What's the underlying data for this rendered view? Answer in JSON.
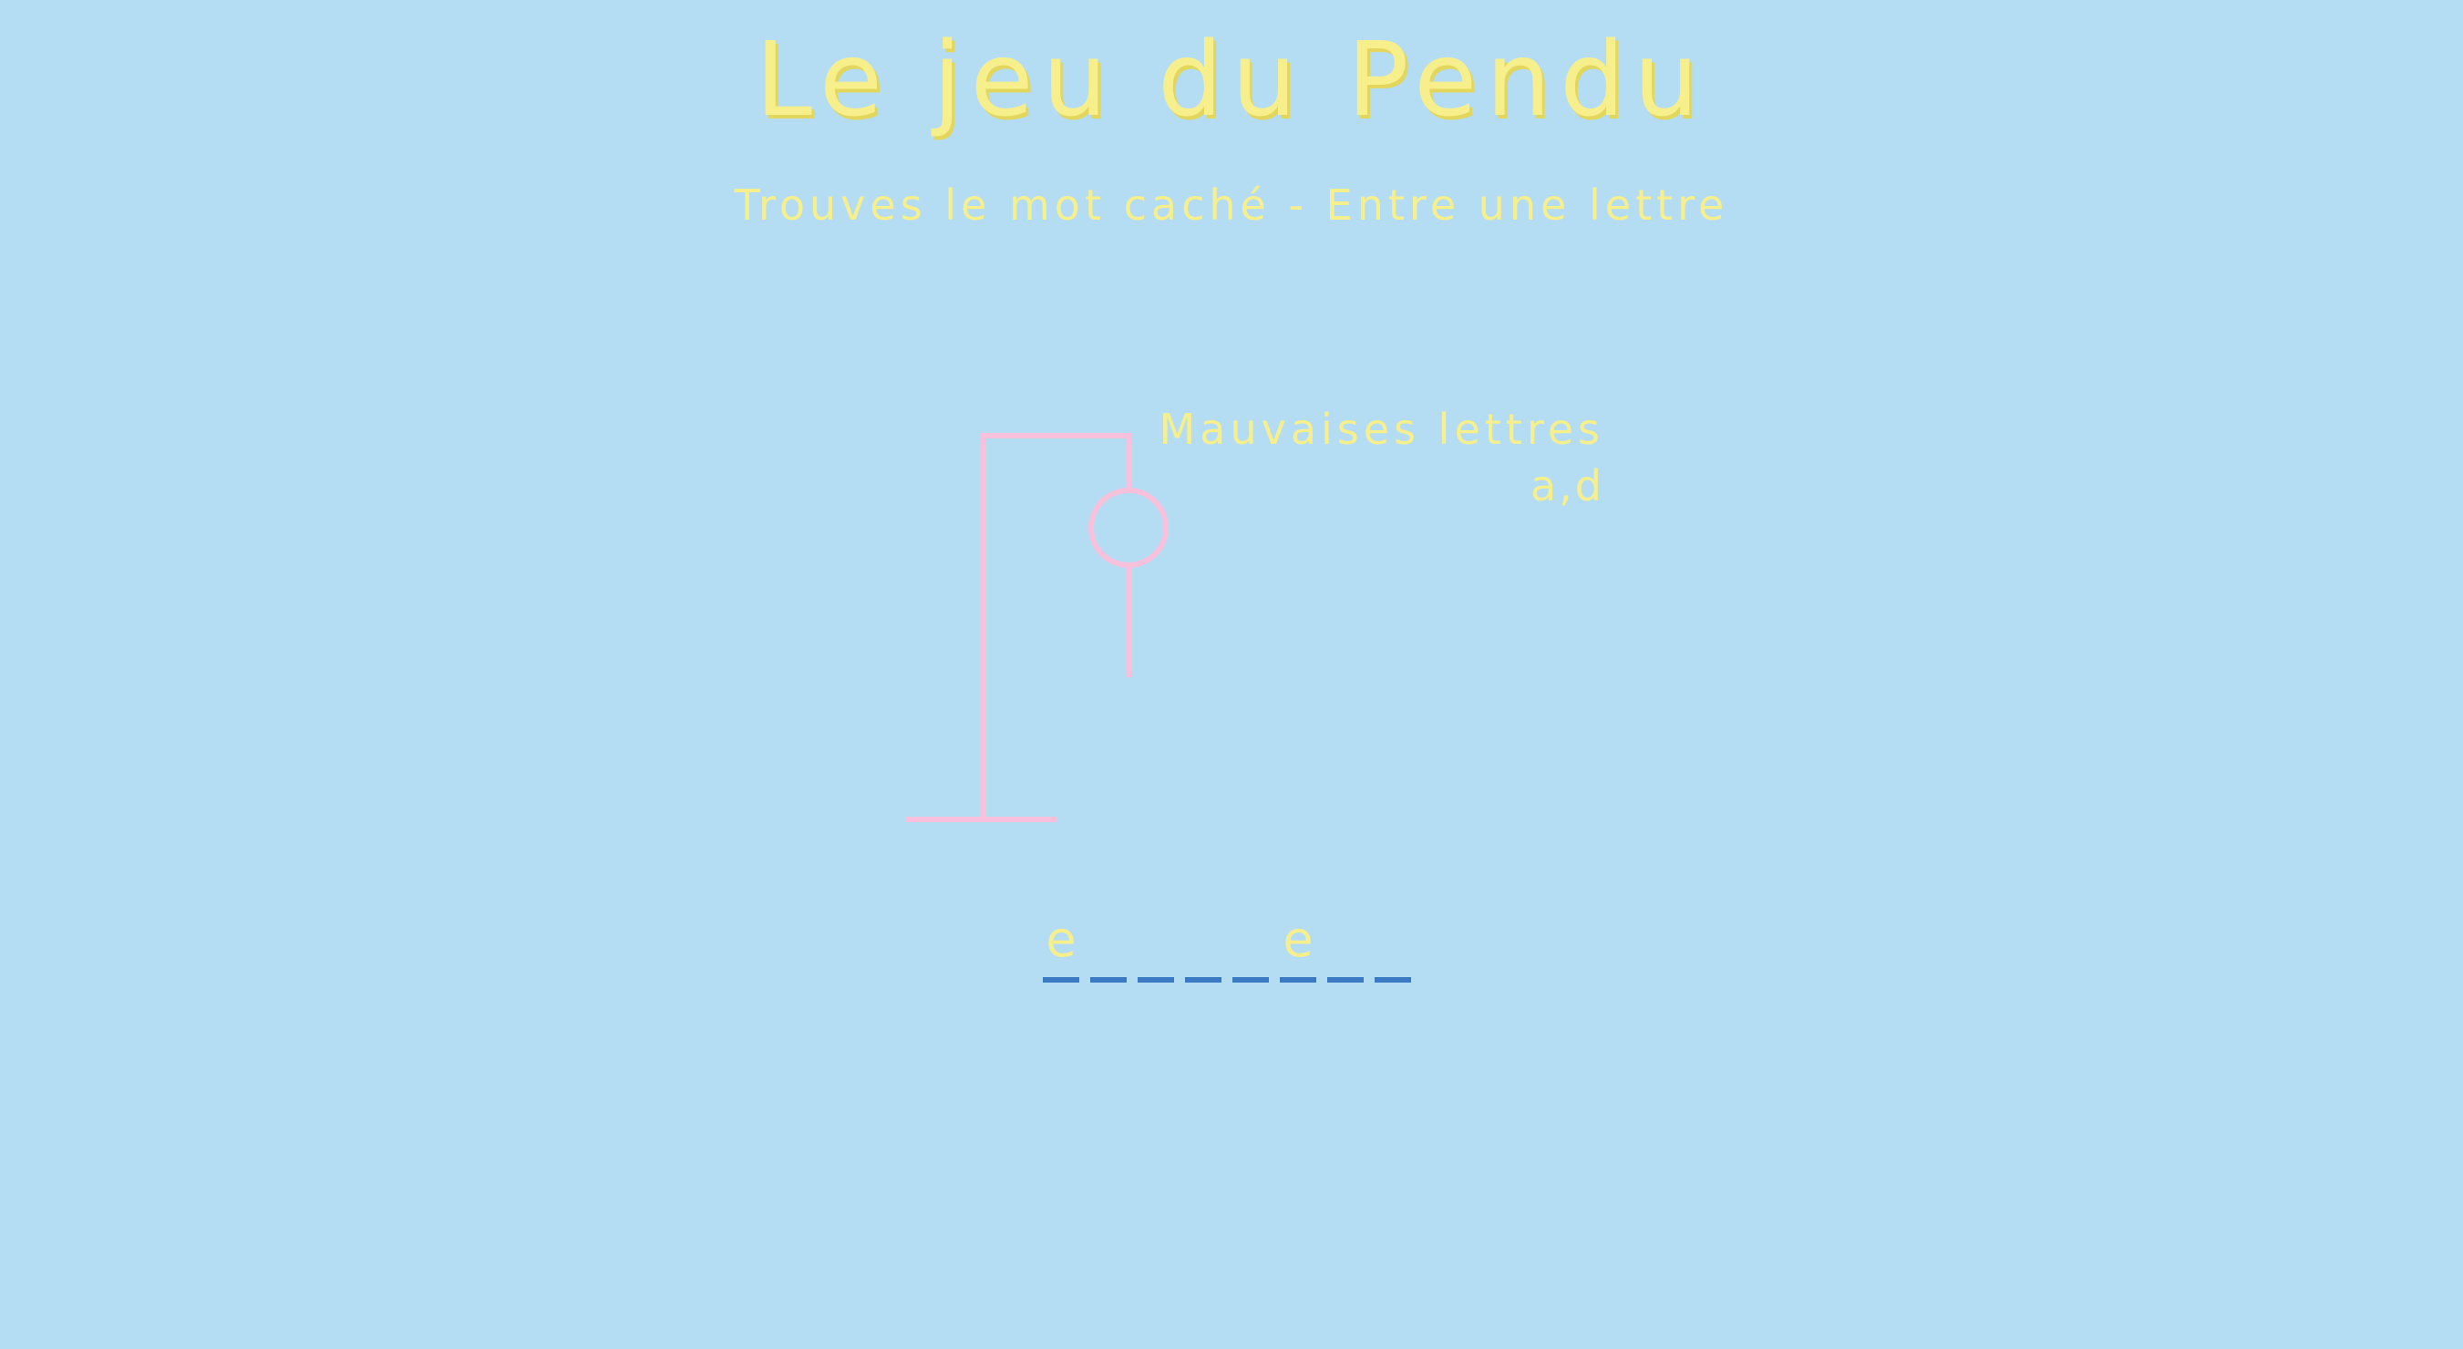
{
  "header": {
    "title": "Le jeu du Pendu",
    "subtitle": "Trouves le mot caché - Entre une lettre"
  },
  "wrong_letters": {
    "heading": "Mauvaises lettres",
    "letters": "a,d"
  },
  "word": {
    "slots": [
      "e",
      "",
      "",
      "",
      "",
      "e",
      "",
      ""
    ]
  },
  "hangman": {
    "parts_shown": [
      "gallows",
      "head",
      "body"
    ]
  },
  "colors": {
    "background": "#b4ddf4",
    "text": "#f7ef8c",
    "figure": "#f9c0dc",
    "underline": "#3b7bc4"
  }
}
